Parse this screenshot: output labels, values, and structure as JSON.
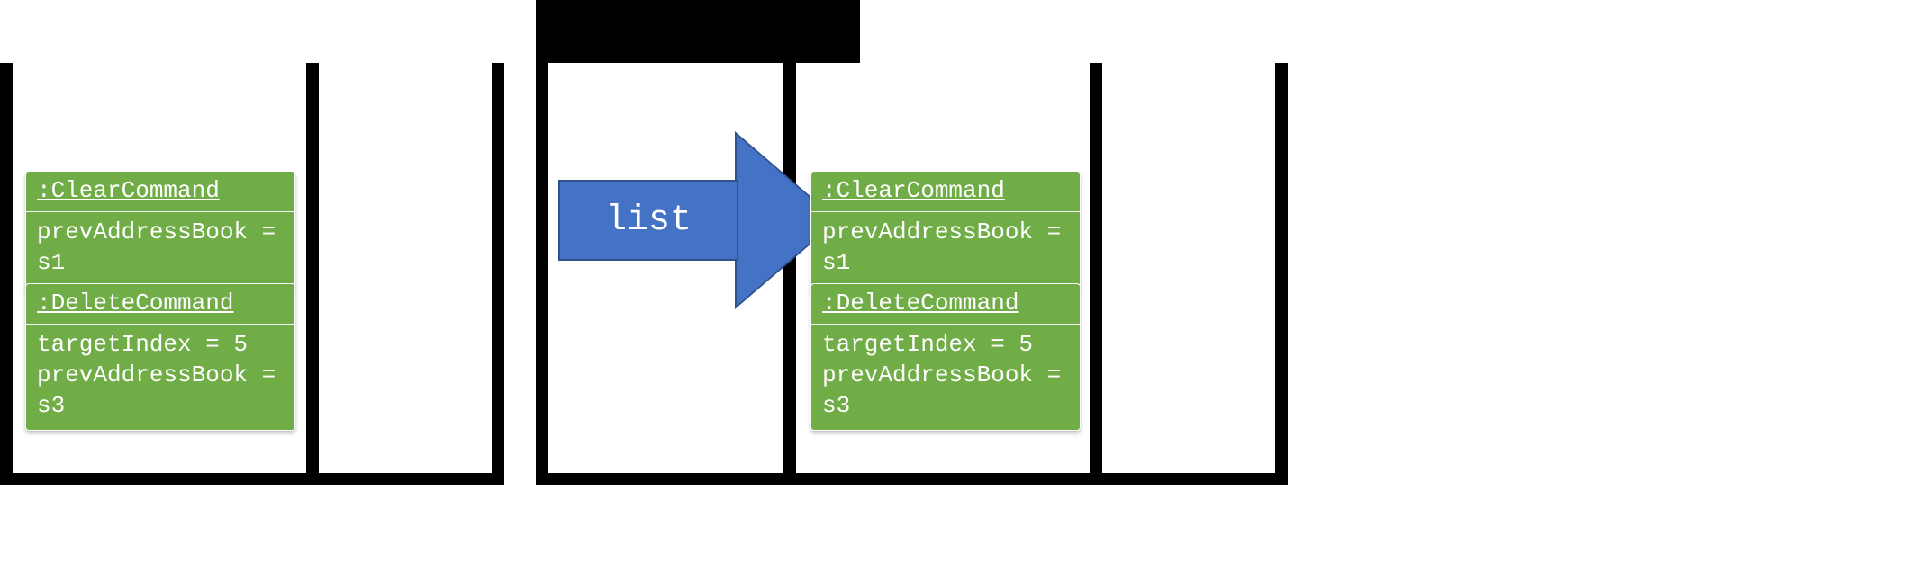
{
  "arrow": {
    "label": "list",
    "color": "#4472C4",
    "borderColor": "#2F528F"
  },
  "left": {
    "clearCommand": {
      "title": ":ClearCommand",
      "line1": "prevAddressBook = s1"
    },
    "deleteCommand": {
      "title": ":DeleteCommand",
      "line1": "targetIndex = 5",
      "line2": "prevAddressBook = s3"
    }
  },
  "right": {
    "clearCommand": {
      "title": ":ClearCommand",
      "line1": "prevAddressBook = s1"
    },
    "deleteCommand": {
      "title": ":DeleteCommand",
      "line1": "targetIndex = 5",
      "line2": "prevAddressBook = s3"
    }
  }
}
